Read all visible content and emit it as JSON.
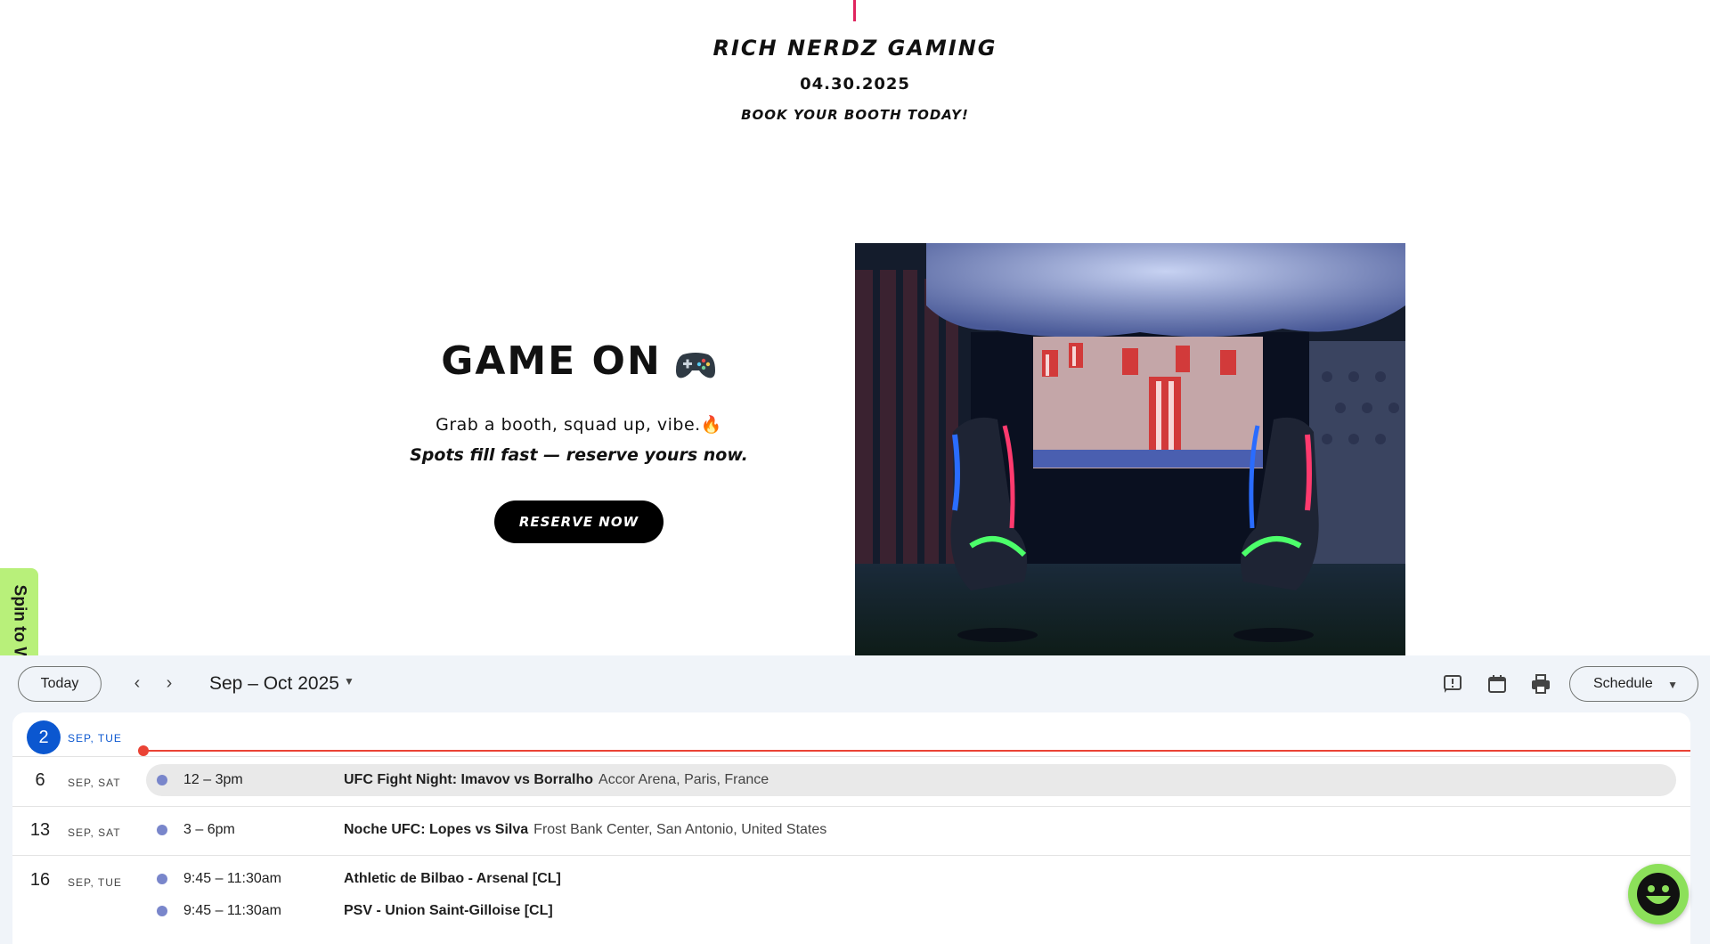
{
  "brand": {
    "title": "RICH NERDZ GAMING",
    "date": "04.30.2025",
    "tagline": "BOOK YOUR BOOTH TODAY!"
  },
  "hero": {
    "title": "GAME ON",
    "line1": "Grab a booth, squad up, vibe.🔥",
    "line2": "Spots fill fast — reserve yours now.",
    "cta_label": "RESERVE NOW"
  },
  "promo": {
    "spin_label": "Spin to Win!",
    "close_glyph": "×"
  },
  "calendar": {
    "today_label": "Today",
    "prev_glyph": "‹",
    "next_glyph": "›",
    "range_label": "Sep – Oct 2025",
    "view_label": "Schedule",
    "days": [
      {
        "num": "2",
        "label": "SEP, TUE",
        "is_today": true,
        "events": []
      },
      {
        "num": "6",
        "label": "SEP, SAT",
        "events": [
          {
            "time": "12 – 3pm",
            "title": "UFC Fight Night: Imavov vs Borralho",
            "location": "Accor Arena, Paris, France"
          }
        ]
      },
      {
        "num": "13",
        "label": "SEP, SAT",
        "events": [
          {
            "time": "3 – 6pm",
            "title": "Noche UFC: Lopes vs Silva",
            "location": "Frost Bank Center, San Antonio, United States"
          }
        ]
      },
      {
        "num": "16",
        "label": "SEP, TUE",
        "events": [
          {
            "time": "9:45 – 11:30am",
            "title": "Athletic de Bilbao - Arsenal [CL]",
            "location": ""
          },
          {
            "time": "9:45 – 11:30am",
            "title": "PSV - Union Saint-Gilloise [CL]",
            "location": ""
          }
        ]
      }
    ]
  },
  "colors": {
    "accent_blue": "#0b57d0",
    "now_red": "#ea4335",
    "event_dot": "#7986cb",
    "promo_green": "#b8f07a"
  }
}
